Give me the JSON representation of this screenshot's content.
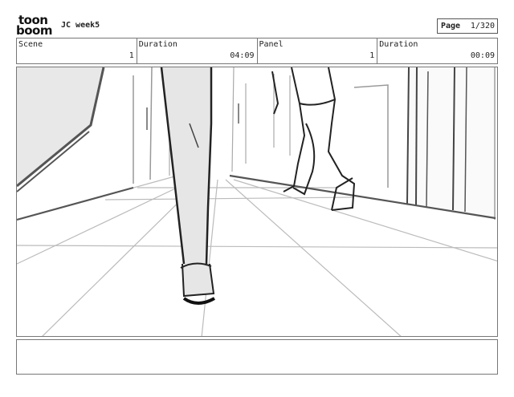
{
  "header": {
    "logo_line1": "toon",
    "logo_line2": "boom",
    "project_title": "JC week5",
    "page_label": "Page",
    "page_value": "1/320"
  },
  "info": [
    {
      "label": "Scene",
      "value": "1"
    },
    {
      "label": "Duration",
      "value": "04:09"
    },
    {
      "label": "Panel",
      "value": "1"
    },
    {
      "label": "Duration",
      "value": "00:09"
    }
  ],
  "notes": {
    "text": ""
  }
}
